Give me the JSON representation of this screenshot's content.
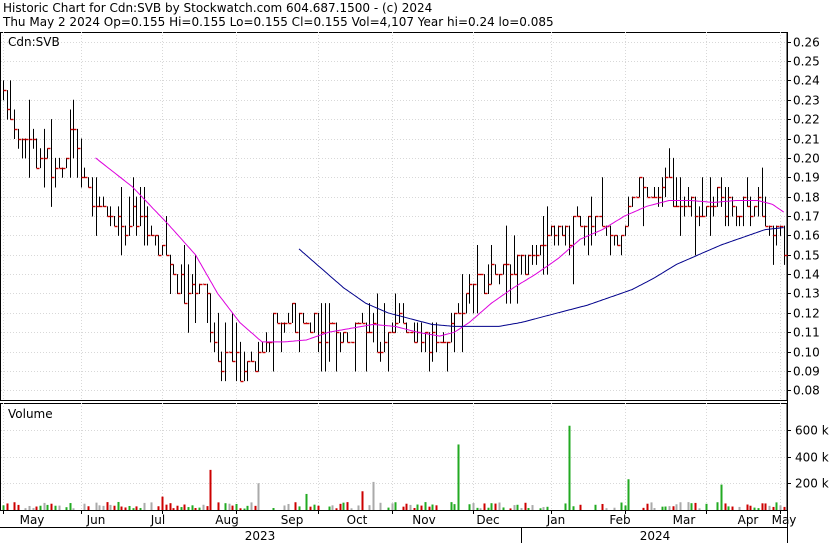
{
  "header": {
    "line1": "Historic Chart for Cdn:SVB by Stockwatch.com 604.687.1500 - (c) 2024",
    "line2": "Thu May  2 2024   Op=0.155  Hi=0.155  Lo=0.155  Cl=0.155  Vol=4,107  Year hi=0.24  lo=0.085"
  },
  "colors": {
    "price_bar": "#000000",
    "close_tick": "#cc0000",
    "ma_short": "#dd00dd",
    "ma_long": "#00008b",
    "vol_up": "#22aa22",
    "vol_down": "#cc0000",
    "vol_flat": "#aaaaaa"
  },
  "chart_data": [
    {
      "type": "line",
      "title": "Cdn:SVB",
      "ylim": [
        0.075,
        0.265
      ],
      "yticks": [
        "0.26",
        "0.25",
        "0.24",
        "0.23",
        "0.22",
        "0.21",
        "0.20",
        "0.19",
        "0.18",
        "0.17",
        "0.16",
        "0.15",
        "0.14",
        "0.13",
        "0.12",
        "0.11",
        "0.10",
        "0.09",
        "0.08"
      ],
      "x_months": [
        "May",
        "Jun",
        "Jul",
        "Aug",
        "Sep",
        "Oct",
        "Nov",
        "Dec",
        "Jan",
        "Feb",
        "Mar",
        "Apr",
        "May"
      ],
      "x_years": [
        "2023",
        "2024"
      ],
      "price_anchors": [
        [
          0,
          0.235
        ],
        [
          3,
          0.215
        ],
        [
          7,
          0.205
        ],
        [
          10,
          0.2
        ],
        [
          14,
          0.195
        ],
        [
          17,
          0.205
        ],
        [
          19,
          0.21
        ],
        [
          22,
          0.19
        ],
        [
          25,
          0.175
        ],
        [
          28,
          0.17
        ],
        [
          31,
          0.165
        ],
        [
          34,
          0.165
        ],
        [
          37,
          0.175
        ],
        [
          40,
          0.16
        ],
        [
          43,
          0.155
        ],
        [
          46,
          0.14
        ],
        [
          49,
          0.13
        ],
        [
          52,
          0.135
        ],
        [
          54,
          0.14
        ],
        [
          56,
          0.11
        ],
        [
          58,
          0.095
        ],
        [
          61,
          0.1
        ],
        [
          64,
          0.09
        ],
        [
          67,
          0.095
        ],
        [
          70,
          0.1
        ],
        [
          72,
          0.11
        ],
        [
          74,
          0.12
        ],
        [
          77,
          0.12
        ],
        [
          80,
          0.115
        ],
        [
          83,
          0.115
        ],
        [
          86,
          0.11
        ],
        [
          89,
          0.115
        ],
        [
          92,
          0.105
        ],
        [
          95,
          0.11
        ],
        [
          98,
          0.115
        ],
        [
          101,
          0.105
        ],
        [
          104,
          0.11
        ],
        [
          107,
          0.12
        ],
        [
          110,
          0.11
        ],
        [
          113,
          0.105
        ],
        [
          116,
          0.105
        ],
        [
          119,
          0.11
        ],
        [
          122,
          0.115
        ],
        [
          125,
          0.13
        ],
        [
          128,
          0.14
        ],
        [
          131,
          0.135
        ],
        [
          134,
          0.145
        ],
        [
          137,
          0.14
        ],
        [
          140,
          0.145
        ],
        [
          143,
          0.15
        ],
        [
          146,
          0.155
        ],
        [
          149,
          0.16
        ],
        [
          152,
          0.16
        ],
        [
          155,
          0.165
        ],
        [
          158,
          0.17
        ],
        [
          161,
          0.165
        ],
        [
          164,
          0.165
        ],
        [
          167,
          0.16
        ],
        [
          170,
          0.18
        ],
        [
          173,
          0.185
        ],
        [
          176,
          0.18
        ],
        [
          179,
          0.185
        ],
        [
          182,
          0.18
        ],
        [
          185,
          0.18
        ],
        [
          188,
          0.175
        ],
        [
          191,
          0.175
        ],
        [
          194,
          0.18
        ],
        [
          197,
          0.17
        ],
        [
          200,
          0.175
        ],
        [
          203,
          0.175
        ],
        [
          206,
          0.17
        ],
        [
          208,
          0.165
        ],
        [
          210,
          0.165
        ],
        [
          211,
          0.155
        ]
      ],
      "ma_short_anchors": [
        [
          25,
          0.2
        ],
        [
          35,
          0.185
        ],
        [
          45,
          0.165
        ],
        [
          52,
          0.15
        ],
        [
          58,
          0.13
        ],
        [
          64,
          0.115
        ],
        [
          70,
          0.105
        ],
        [
          76,
          0.105
        ],
        [
          82,
          0.106
        ],
        [
          88,
          0.11
        ],
        [
          94,
          0.112
        ],
        [
          100,
          0.114
        ],
        [
          106,
          0.113
        ],
        [
          112,
          0.11
        ],
        [
          118,
          0.108
        ],
        [
          122,
          0.11
        ],
        [
          126,
          0.115
        ],
        [
          132,
          0.125
        ],
        [
          138,
          0.133
        ],
        [
          144,
          0.14
        ],
        [
          150,
          0.148
        ],
        [
          156,
          0.158
        ],
        [
          162,
          0.163
        ],
        [
          168,
          0.17
        ],
        [
          174,
          0.175
        ],
        [
          180,
          0.178
        ],
        [
          186,
          0.178
        ],
        [
          192,
          0.177
        ],
        [
          198,
          0.178
        ],
        [
          204,
          0.178
        ],
        [
          208,
          0.176
        ],
        [
          211,
          0.172
        ]
      ],
      "ma_long_anchors": [
        [
          80,
          0.153
        ],
        [
          86,
          0.143
        ],
        [
          92,
          0.133
        ],
        [
          98,
          0.125
        ],
        [
          104,
          0.12
        ],
        [
          110,
          0.117
        ],
        [
          116,
          0.114
        ],
        [
          122,
          0.113
        ],
        [
          128,
          0.113
        ],
        [
          134,
          0.113
        ],
        [
          140,
          0.115
        ],
        [
          146,
          0.118
        ],
        [
          152,
          0.121
        ],
        [
          158,
          0.124
        ],
        [
          164,
          0.128
        ],
        [
          170,
          0.132
        ],
        [
          176,
          0.138
        ],
        [
          182,
          0.145
        ],
        [
          188,
          0.15
        ],
        [
          194,
          0.155
        ],
        [
          200,
          0.159
        ],
        [
          206,
          0.163
        ],
        [
          211,
          0.164
        ]
      ]
    },
    {
      "type": "bar",
      "title": "Volume",
      "ylim": [
        0,
        800000
      ],
      "yticks": [
        "600 k",
        "400 k",
        "200 k"
      ],
      "spikes": [
        {
          "day": 56,
          "value": 300000,
          "dir": "down"
        },
        {
          "day": 123,
          "value": 490000,
          "dir": "up"
        },
        {
          "day": 153,
          "value": 630000,
          "dir": "up"
        },
        {
          "day": 169,
          "value": 230000,
          "dir": "up"
        },
        {
          "day": 194,
          "value": 190000,
          "dir": "up"
        },
        {
          "day": 69,
          "value": 200000,
          "dir": "flat"
        },
        {
          "day": 100,
          "value": 210000,
          "dir": "flat"
        },
        {
          "day": 97,
          "value": 140000,
          "dir": "down"
        },
        {
          "day": 43,
          "value": 100000,
          "dir": "down"
        },
        {
          "day": 82,
          "value": 120000,
          "dir": "up"
        }
      ]
    }
  ]
}
